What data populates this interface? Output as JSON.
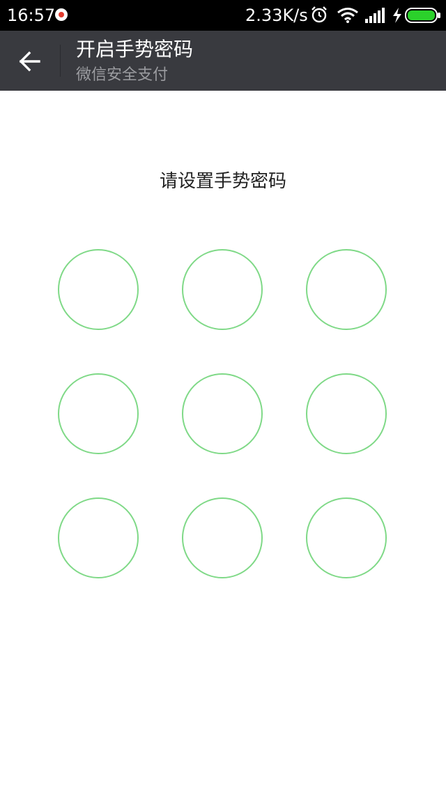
{
  "status_bar": {
    "time": "16:57",
    "network_speed": "2.33K/s",
    "icons": [
      "app-notification-icon",
      "alarm-icon",
      "wifi-icon",
      "signal-icon",
      "charging-icon",
      "battery-icon"
    ]
  },
  "app_bar": {
    "title": "开启手势密码",
    "subtitle": "微信安全支付",
    "back_icon": "arrow-left-icon"
  },
  "main": {
    "prompt": "请设置手势密码",
    "pattern": {
      "rows": 3,
      "cols": 3
    }
  },
  "colors": {
    "status_bar_bg": "#000000",
    "app_bar_bg": "#393a3f",
    "node_border": "#7fd987",
    "battery": "#2bd12b"
  }
}
